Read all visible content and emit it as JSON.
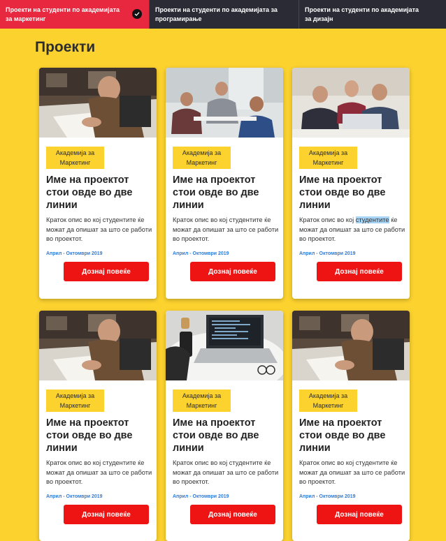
{
  "tabs": [
    {
      "label": "Проекти на студенти по академијата за маркетинг",
      "active": true,
      "icon": "check-icon"
    },
    {
      "label": "Проекти на студенти по академијата за програмирање",
      "active": false
    },
    {
      "label": "Проекти на студенти по академијата за дизајн",
      "active": false
    }
  ],
  "page": {
    "title": "Проекти"
  },
  "colors": {
    "background": "#fcd22f",
    "accent_red": "#ef1414",
    "active_tab": "#e8283f",
    "tab_bar": "#2b2b35",
    "date_blue": "#2f7bd6"
  },
  "cards": [
    {
      "image": "person-drawing-photo",
      "badge": "Академија за Маркетинг",
      "title": "Име на проектот стои овде во две линии",
      "desc": "Краток опис во кој студентите ќе можат да опишат за што се работи во проектот.",
      "date": "Април - Октомври 2019",
      "button": "Дознај повеќе"
    },
    {
      "image": "office-meeting-photo",
      "badge": "Академија за Маркетинг",
      "title": "Име на проектот стои овде во две линии",
      "desc": "Краток опис во кој студентите ќе можат да опишат за што се работи во проектот.",
      "date": "Април - Октомври 2019",
      "button": "Дознај повеќе"
    },
    {
      "image": "team-laptop-photo",
      "badge": "Академија за Маркетинг",
      "title": "Име на проектот стои овде во две линии",
      "desc_a": "Краток опис во кој",
      "desc_hl": "студентите",
      "desc_b": "ќе можат да опишат за што се работи во проектот.",
      "date": "Април - Октомври 2019",
      "button": "Дознај повеќе"
    },
    {
      "image": "person-drawing-photo",
      "badge": "Академија за Маркетинг",
      "title": "Име на проектот стои овде во две линии",
      "desc": "Краток опис во кој студентите ќе можат да опишат за што се работи во проектот.",
      "date": "Април - Октомври 2019",
      "button": "Дознај повеќе"
    },
    {
      "image": "laptop-code-photo",
      "badge": "Академија за Маркетинг",
      "title": "Име на проектот стои овде во две линии",
      "desc": "Краток опис во кој студентите ќе можат да опишат за што се работи во проектот.",
      "date": "Април - Октомври 2019",
      "button": "Дознај повеќе"
    },
    {
      "image": "person-drawing-photo",
      "badge": "Академија за Маркетинг",
      "title": "Име на проектот стои овде во две линии",
      "desc": "Краток опис во кој студентите ќе можат да опишат за што се работи во проектот.",
      "date": "Април - Октомври 2019",
      "button": "Дознај повеќе"
    }
  ]
}
